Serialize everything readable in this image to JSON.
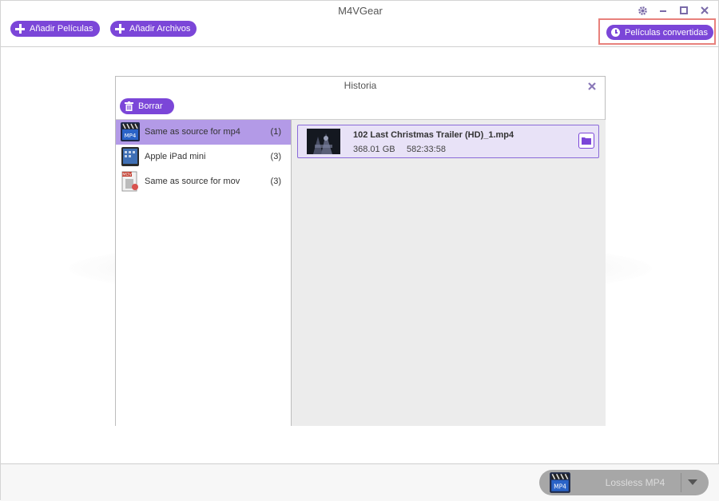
{
  "window": {
    "title": "M4VGear"
  },
  "toolbar": {
    "add_movies_label": "Añadir Películas",
    "add_files_label": "Añadir Archivos",
    "converted_label": "Películas convertidas"
  },
  "history": {
    "title": "Historia",
    "delete_label": "Borrar",
    "profiles": [
      {
        "name": "Same as source for mp4",
        "count": "(1)",
        "icon": "mp4-video-icon",
        "selected": true
      },
      {
        "name": "Apple iPad mini",
        "count": "(3)",
        "icon": "ipad-icon",
        "selected": false
      },
      {
        "name": "Same as source for mov",
        "count": "(3)",
        "icon": "mov-file-icon",
        "selected": false
      }
    ],
    "files": [
      {
        "name": "102 Last Christmas Trailer (HD)_1.mp4",
        "size": "368.01 GB",
        "duration": "582:33:58"
      }
    ]
  },
  "output": {
    "format_label": "Lossless MP4"
  },
  "colors": {
    "accent": "#7b46d8",
    "selected_row": "#b39ae7",
    "highlight_frame": "#e8817c"
  }
}
